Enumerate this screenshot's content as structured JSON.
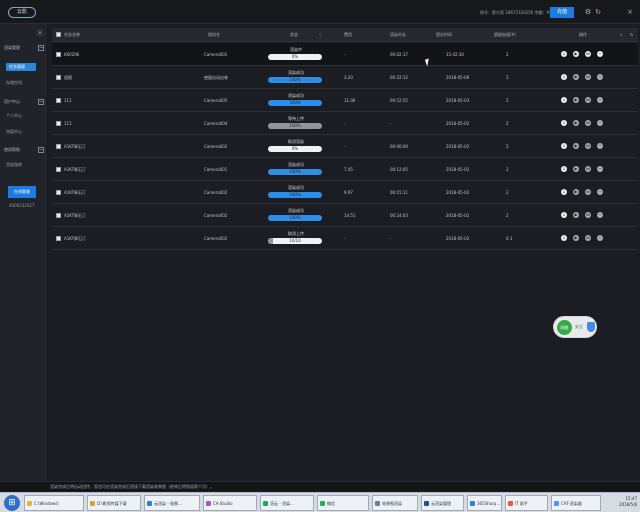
{
  "app": {
    "logo": "云影",
    "account": "账号：默兴耳 18672326256 余额：¥56.12",
    "recharge_label": "充值",
    "icons": [
      "gear-icon",
      "refresh-icon",
      "close-icon"
    ]
  },
  "sidebar": {
    "collapse_glyph": "«",
    "groups": [
      {
        "label": "渲染管理",
        "toggle": "−",
        "items": [
          "任务管理",
          "存储空间"
        ]
      },
      {
        "label": "用户中心",
        "toggle": "−",
        "items": [
          "个人中心",
          "充值中心"
        ]
      },
      {
        "label": "使用帮助",
        "toggle": "−",
        "items": [
          "渲染指南"
        ]
      }
    ],
    "button_label": "在线客服",
    "phone": "4006232027"
  },
  "table": {
    "headers": [
      "任务名称",
      "相机名",
      "状态",
      "费用",
      "渲染时长",
      "提交时间",
      "超级加速(¥)",
      "操作"
    ],
    "rows": [
      {
        "name": "K60296",
        "camera": "Camera001",
        "status": "渲染中",
        "progress": 0,
        "progress_label": "0%",
        "fee": "-",
        "duration": "00:02:17",
        "submitted": "15:42:30",
        "speed": "2",
        "gray": false,
        "hover": true
      },
      {
        "name": "组图",
        "camera": "使窗自动出卷",
        "status": "渲染成功",
        "progress": 100,
        "progress_label": "100%",
        "fee": "3.20",
        "duration": "00:22:12",
        "submitted": "2018-05-06",
        "speed": "2",
        "gray": false,
        "hover": false
      },
      {
        "name": "111",
        "camera": "Camera005",
        "status": "渲染成功",
        "progress": 100,
        "progress_label": "100%",
        "fee": "11.06",
        "duration": "00:52:55",
        "submitted": "2018-05-03",
        "speed": "2",
        "gray": false,
        "hover": false
      },
      {
        "name": "111",
        "camera": "Camera004",
        "status": "等待上传",
        "progress": 100,
        "progress_label": "100%",
        "fee": "-",
        "duration": "-",
        "submitted": "2018-05-02",
        "speed": "2",
        "gray": true,
        "hover": false
      },
      {
        "name": "A1KT辉石汀",
        "camera": "Camera002",
        "status": "取消渲染",
        "progress": 0,
        "progress_label": "0%",
        "fee": "-",
        "duration": "00:00:00",
        "submitted": "2018-05-02",
        "speed": "2",
        "gray": false,
        "hover": false
      },
      {
        "name": "A1KT辉石汀",
        "camera": "Camera001",
        "status": "渲染成功",
        "progress": 100,
        "progress_label": "100%",
        "fee": "7.45",
        "duration": "00:12:05",
        "submitted": "2018-05-02",
        "speed": "2",
        "gray": false,
        "hover": false
      },
      {
        "name": "A1KT辉石汀",
        "camera": "Camera002",
        "status": "渲染成功",
        "progress": 100,
        "progress_label": "100%",
        "fee": "9.97",
        "duration": "00:15:11",
        "submitted": "2018-05-02",
        "speed": "2",
        "gray": false,
        "hover": false
      },
      {
        "name": "A1KT辉石汀",
        "camera": "Camera002",
        "status": "渲染成功",
        "progress": 100,
        "progress_label": "100%",
        "fee": "14.51",
        "duration": "00:24:03",
        "submitted": "2018-05-02",
        "speed": "2",
        "gray": false,
        "hover": false
      },
      {
        "name": "A1KT辉石汀",
        "camera": "Camera002",
        "status": "取消上传",
        "progress": 10,
        "progress_label": "10/10",
        "fee": "-",
        "duration": "-",
        "submitted": "2018-05-02",
        "speed": "0.1",
        "gray": true,
        "hover": false
      }
    ],
    "operations": [
      {
        "name": "download-icon",
        "glyph": "↓"
      },
      {
        "name": "play-icon",
        "glyph": "▶"
      },
      {
        "name": "share-icon",
        "glyph": "⋈"
      },
      {
        "name": "delete-icon",
        "glyph": "−"
      }
    ],
    "header_icons": [
      "search-icon",
      "refresh-icon"
    ]
  },
  "widget": {
    "left": "网络",
    "right": "安全"
  },
  "notice": "渲染完成后将自动回传，您也可在渲染完成后直接下载渲染效果图（结束后将保留两个月）。",
  "taskbar": {
    "items": [
      "C:\\Windows\\",
      "D:\\影视传媒下载",
      "云渲染 - 效果...",
      "CA-Studio",
      "渲云 - 渲染...",
      "微信",
      "效果图渲染",
      "云渲染管理",
      "365Sharp...",
      "IT 助手",
      "CAT-渲染器"
    ],
    "clock_time": "15:47",
    "clock_date": "2018/5/8"
  }
}
